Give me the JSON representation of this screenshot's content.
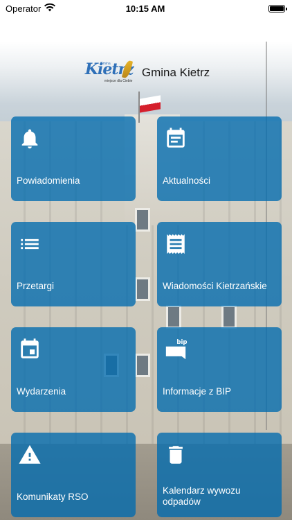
{
  "status_bar": {
    "carrier": "Operator",
    "time": "10:15 AM"
  },
  "header": {
    "logo_text": "Kietrz",
    "logo_prefix": "Gmina",
    "logo_tagline": "miejsce dla Ciebie",
    "title": "Gmina Kietrz"
  },
  "tiles": [
    {
      "label": "Powiadomienia",
      "icon": "bell-icon"
    },
    {
      "label": "Aktualności",
      "icon": "calendar-news-icon"
    },
    {
      "label": "Przetargi",
      "icon": "list-icon"
    },
    {
      "label": "Wiadomości Kietrzańskie",
      "icon": "receipt-icon"
    },
    {
      "label": "Wydarzenia",
      "icon": "event-calendar-icon"
    },
    {
      "label": "Informacje z BIP",
      "icon": "bip-icon"
    },
    {
      "label": "Komunikaty RSO",
      "icon": "warning-icon"
    },
    {
      "label": "Kalendarz wywozu odpadów",
      "icon": "trash-icon"
    }
  ],
  "colors": {
    "tile_background": "#006aae",
    "tile_text": "#ffffff"
  }
}
